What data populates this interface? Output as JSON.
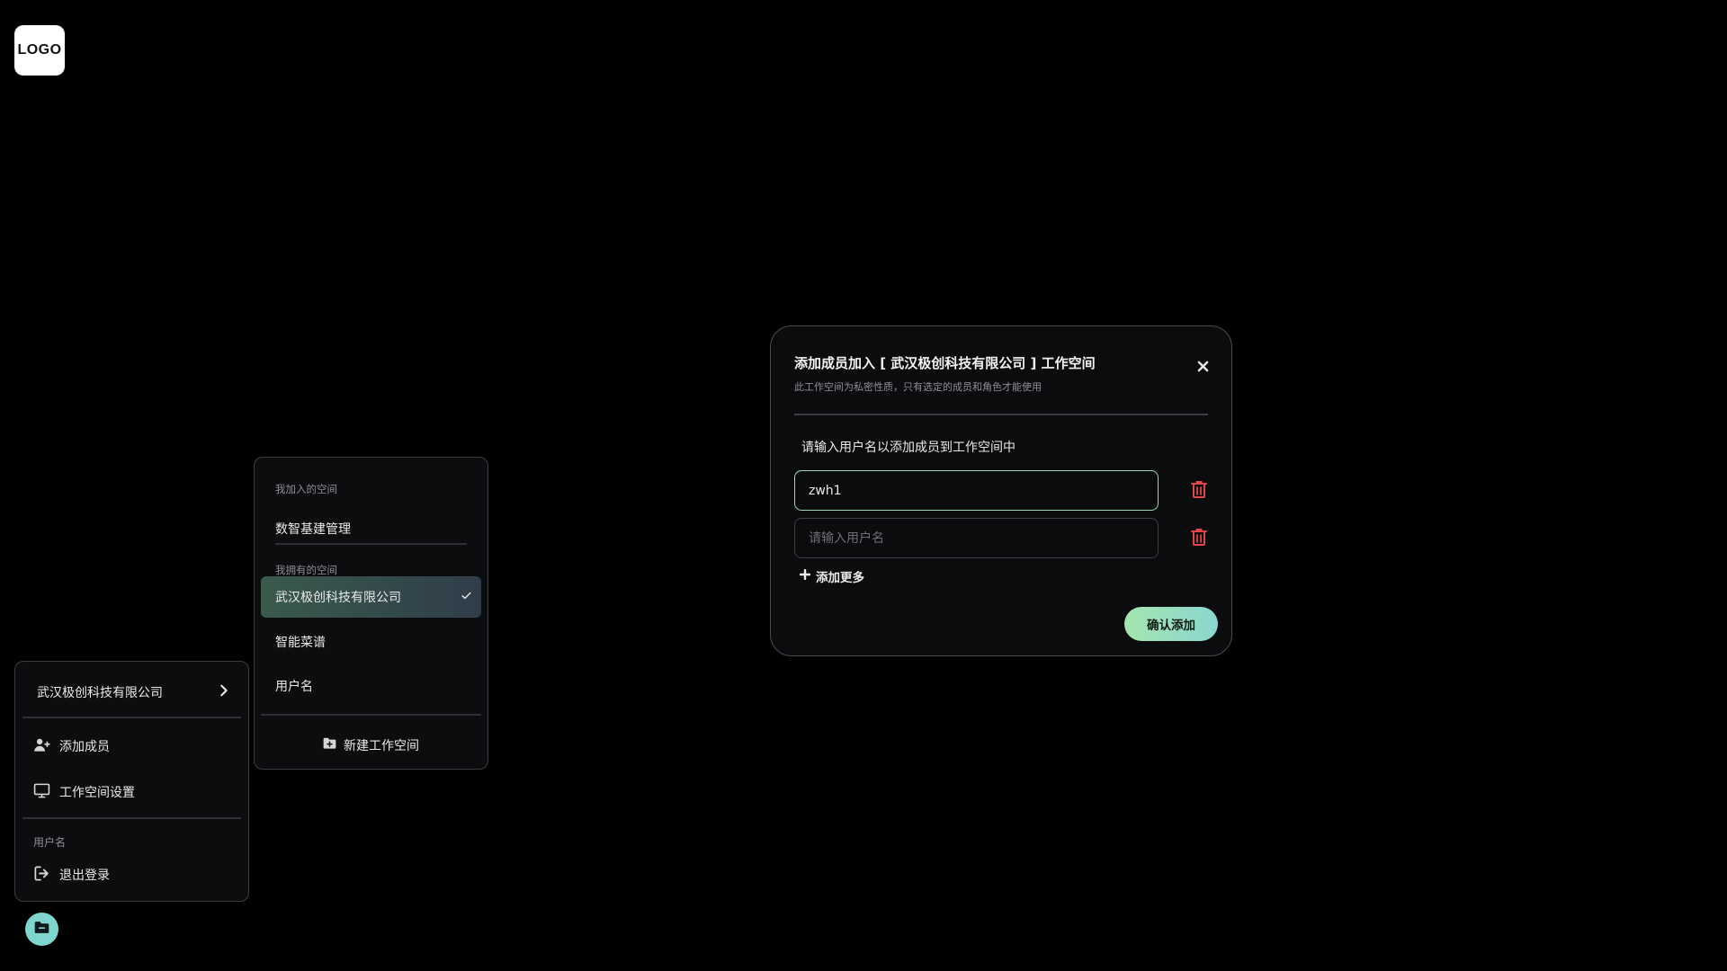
{
  "logo": {
    "text": "LOGO"
  },
  "workspace_menu": {
    "current_workspace": "武汉极创科技有限公司",
    "items": [
      {
        "label": "添加成员",
        "icon": "user-plus-icon"
      },
      {
        "label": "工作空间设置",
        "icon": "monitor-icon"
      }
    ],
    "user_label": "用户名",
    "logout_label": "退出登录"
  },
  "workspace_list": {
    "joined_section_label": "我加入的空间",
    "joined": [
      "数智基建管理"
    ],
    "owned_section_label": "我拥有的空间",
    "owned": [
      {
        "label": "武汉极创科技有限公司",
        "selected": true
      },
      {
        "label": "智能菜谱",
        "selected": false
      },
      {
        "label": "用户名",
        "selected": false
      }
    ],
    "new_workspace_label": "新建工作空间"
  },
  "modal": {
    "title": "添加成员加入 [ 武汉极创科技有限公司 ] 工作空间",
    "subtitle": "此工作空间为私密性质，只有选定的成员和角色才能使用",
    "prompt": "请输入用户名以添加成员到工作空间中",
    "inputs": [
      {
        "value": "zwh1",
        "placeholder": "请输入用户名"
      },
      {
        "value": "",
        "placeholder": "请输入用户名"
      }
    ],
    "add_more_label": "添加更多",
    "confirm_label": "确认添加"
  },
  "colors": {
    "accent_green": "#9ad7b4",
    "delete_red": "#e0454a",
    "fab": "#7fd6cf",
    "selected_bg": "#3a5a4c"
  }
}
